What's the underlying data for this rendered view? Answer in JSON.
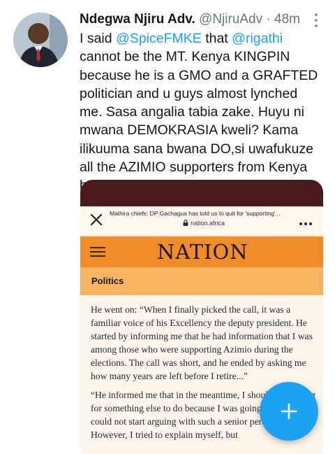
{
  "tweet": {
    "display_name": "Ndegwa Njiru Adv.",
    "handle": "@NjiruAdv",
    "separator": "·",
    "time": "48m",
    "avatar_icon": "profile-photo",
    "text": {
      "part1": "I said ",
      "mention1": "@SpiceFMKE",
      "part2": " that ",
      "mention2": "@rigathi",
      "part3": " cannot be the MT. Kenya KINGPIN because he is a GMO and a GRAFTED politician and u guys almost lynched me. Sasa angalia tabia zake. Huyu ni mwana DEMOKRASIA kweli? Kama ilikuuma sana bwana DO,si uwafukuze all the AZIMIO supporters from Kenya basi."
    },
    "mention_color": "#1da1f2"
  },
  "media": {
    "browser_title": "Mathira chiefs: DP Gachagua has told us to quit for 'supporting'...",
    "browser_url": "nation.africa",
    "logo": "NATION",
    "section": "Politics",
    "paragraph1": "He went on: “When I finally picked the call, it was a familiar voice of his Excellency the deputy president. He started by informing me that he had information that I was among those who were supporting Azimio during the elections. The call was short, and he ended by asking me how many years are left before I retire...”",
    "paragraph2": "“He informed me that in the meantime, I should be looking for something else to do because I was going home. I could not start arguing with such a senior person. However, I tried to explain myself, but",
    "accent_color": "#f28c28",
    "topbar_color": "#4b1a1c"
  },
  "fab": {
    "icon": "plus-icon",
    "color": "#1da1f2"
  }
}
